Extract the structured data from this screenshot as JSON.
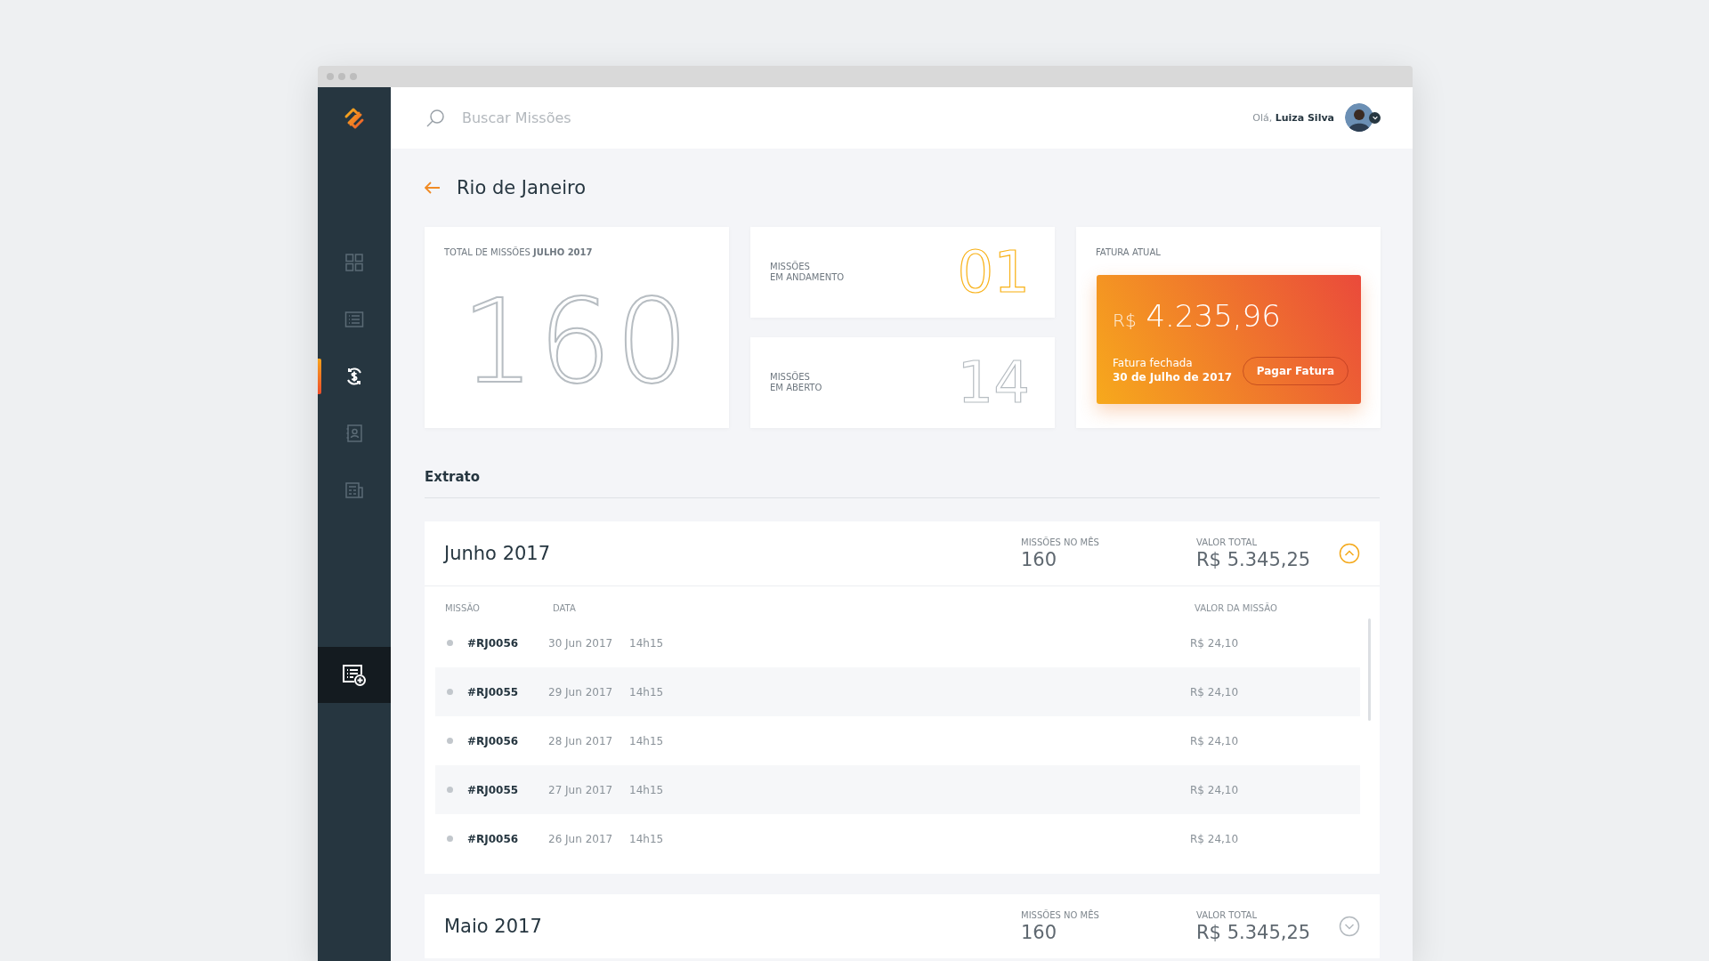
{
  "search": {
    "placeholder": "Buscar Missões"
  },
  "user": {
    "greeting": "Olá,",
    "name": "Luiza Silva"
  },
  "sidebar": {
    "items": [
      {
        "kind": "grid",
        "selected": false
      },
      {
        "kind": "list",
        "selected": false
      },
      {
        "kind": "money",
        "selected": true
      },
      {
        "kind": "contacts",
        "selected": false
      },
      {
        "kind": "news",
        "selected": false
      }
    ]
  },
  "page_title": "Rio de Janeiro",
  "total_card": {
    "label": "TOTAL DE MISSÕES **JULHO 2017**",
    "value": "160"
  },
  "stat_cards": [
    {
      "label_1": "MISSÕES",
      "label_2": "EM ANDAMENTO",
      "value": "01",
      "highlight": true
    },
    {
      "label_1": "MISSÕES",
      "label_2": "EM ABERTO",
      "value": "14",
      "highlight": false
    }
  ],
  "invoice": {
    "label": "FATURA ATUAL",
    "currency": "R$",
    "amount": "4.235,96",
    "status": "Fatura fechada",
    "date": "30 de Julho de 2017",
    "button": "Pagar Fatura"
  },
  "section_title": "Extrato",
  "months": [
    {
      "title": "Junho 2017",
      "missions_label": "MISSÕES NO MÊS",
      "missions": "160",
      "total_label": "VALOR TOTAL",
      "total": "R$ 5.345,25",
      "expanded": true,
      "columns": [
        "MISSÃO",
        "DATA",
        "VALOR DA MISSÃO"
      ],
      "rows": [
        {
          "id": "#RJ0056",
          "date": "30 Jun 2017",
          "time": "14h15",
          "value": "R$ 24,10"
        },
        {
          "id": "#RJ0055",
          "date": "29 Jun 2017",
          "time": "14h15",
          "value": "R$ 24,10"
        },
        {
          "id": "#RJ0056",
          "date": "28 Jun 2017",
          "time": "14h15",
          "value": "R$ 24,10"
        },
        {
          "id": "#RJ0055",
          "date": "27 Jun 2017",
          "time": "14h15",
          "value": "R$ 24,10"
        },
        {
          "id": "#RJ0056",
          "date": "26 Jun 2017",
          "time": "14h15",
          "value": "R$ 24,10"
        }
      ]
    },
    {
      "title": "Maio 2017",
      "missions_label": "MISSÕES NO MÊS",
      "missions": "160",
      "total_label": "VALOR TOTAL",
      "total": "R$ 5.345,25",
      "expanded": false
    }
  ]
}
